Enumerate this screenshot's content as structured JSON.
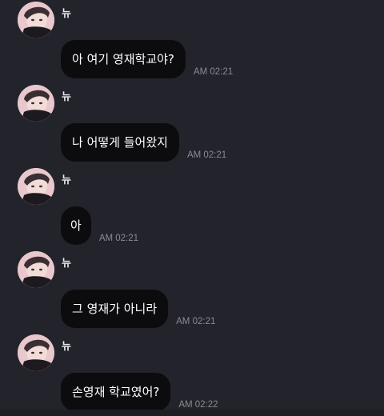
{
  "messages": [
    {
      "sender": "뉴",
      "text": "아 여기 영재학교야?",
      "time": "AM 02:21",
      "avatar": "profile-photo"
    },
    {
      "sender": "뉴",
      "text": "나 어떻게 들어왔지",
      "time": "AM 02:21",
      "avatar": "profile-photo"
    },
    {
      "sender": "뉴",
      "text": "아",
      "time": "AM 02:21",
      "avatar": "profile-photo"
    },
    {
      "sender": "뉴",
      "text": "그 영재가 아니라",
      "time": "AM 02:21",
      "avatar": "profile-photo"
    },
    {
      "sender": "뉴",
      "text": "손영재 학교였어?",
      "time": "AM 02:22",
      "avatar": "profile-photo"
    }
  ],
  "colors": {
    "background": "#23232b",
    "bubble": "#0c0c0f",
    "text": "#ffffff",
    "timestamp": "#8a8a95"
  }
}
